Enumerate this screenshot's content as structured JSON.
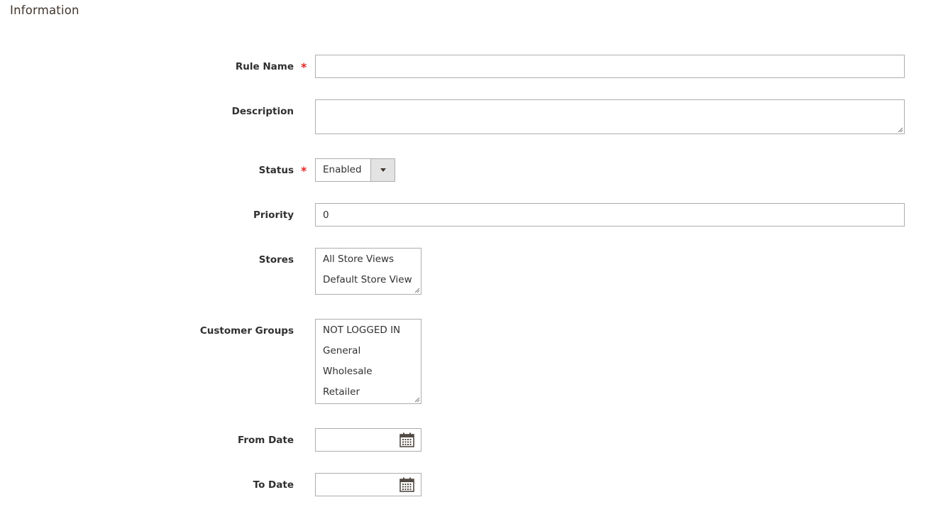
{
  "section": {
    "title": "Information"
  },
  "fields": {
    "rule_name": {
      "label": "Rule Name",
      "required_mark": "*",
      "value": ""
    },
    "description": {
      "label": "Description",
      "value": ""
    },
    "status": {
      "label": "Status",
      "required_mark": "*",
      "value": "Enabled"
    },
    "priority": {
      "label": "Priority",
      "value": "0"
    },
    "stores": {
      "label": "Stores",
      "options": [
        "All Store Views",
        "Default Store View"
      ]
    },
    "customer_groups": {
      "label": "Customer Groups",
      "options": [
        "NOT LOGGED IN",
        "General",
        "Wholesale",
        "Retailer"
      ]
    },
    "from_date": {
      "label": "From Date",
      "value": "",
      "icon": "calendar-icon"
    },
    "to_date": {
      "label": "To Date",
      "value": "",
      "icon": "calendar-icon"
    }
  },
  "colors": {
    "required": "#e22626",
    "border": "#adadad",
    "select_button": "#e3e3e3",
    "label_text": "#303030"
  }
}
